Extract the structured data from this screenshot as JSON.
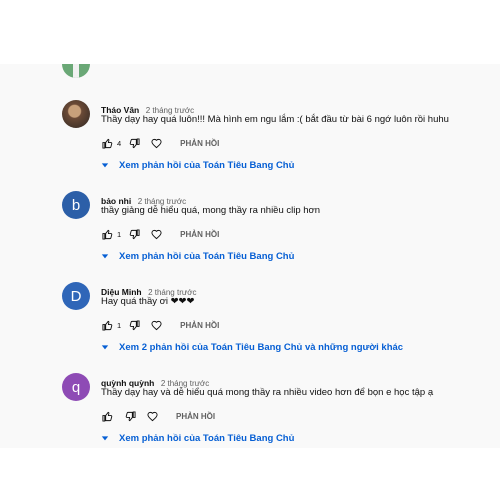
{
  "comments": [
    {
      "author": "Tháo Vân",
      "time": "2 tháng trước",
      "text": "Thầy dạy hay quá luôn!!! Mà hình em ngu lắm :( bắt đầu từ bài 6 ngớ luôn rồi huhu",
      "likes": "4",
      "reply_label": "PHẢN HỒI",
      "view_replies": "Xem phản hồi của Toán Tiêu Bang Chủ"
    },
    {
      "author": "bảo nhi",
      "avatar_letter": "b",
      "time": "2 tháng trước",
      "text": "thầy giảng dễ hiểu quá, mong thầy ra nhiều clip hơn",
      "likes": "1",
      "reply_label": "PHẢN HỒI",
      "view_replies": "Xem phản hồi của Toán Tiêu Bang Chủ"
    },
    {
      "author": "Diệu Minh",
      "avatar_letter": "D",
      "time": "2 tháng trước",
      "text": "Hay quá thầy ơi ❤❤❤",
      "likes": "1",
      "reply_label": "PHẢN HỒI",
      "view_replies": "Xem 2 phản hồi của Toán Tiêu Bang Chủ và những người khác"
    },
    {
      "author": "quỳnh quỳnh",
      "avatar_letter": "q",
      "time": "2 tháng trước",
      "text": "Thầy dạy hay và dễ hiểu quá mong thầy ra nhiều video hơn để bọn e học tập ạ",
      "likes": "",
      "reply_label": "PHẢN HỒI",
      "view_replies": "Xem phản hồi của Toán Tiêu Bang Chủ"
    }
  ],
  "colors": {
    "accent_blue": "#065fd4",
    "panel_bg": "#f9f9f9"
  },
  "icons": [
    "thumb-up-icon",
    "thumb-down-icon",
    "heart-icon",
    "caret-down-icon"
  ]
}
